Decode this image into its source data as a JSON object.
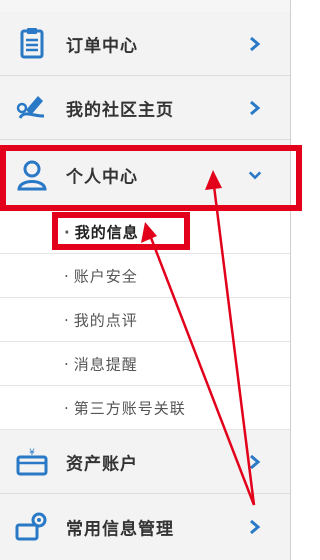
{
  "menu": {
    "order_center": {
      "label": "订单中心",
      "icon": "clipboard-icon"
    },
    "community": {
      "label": "我的社区主页",
      "icon": "edit-pen-icon"
    },
    "personal_center": {
      "label": "个人中心",
      "icon": "user-icon",
      "expanded": true,
      "items": [
        {
          "label": "我的信息",
          "active": true
        },
        {
          "label": "账户安全"
        },
        {
          "label": "我的点评"
        },
        {
          "label": "消息提醒"
        },
        {
          "label": "第三方账号关联"
        }
      ]
    },
    "assets": {
      "label": "资产账户",
      "icon": "wallet-icon"
    },
    "common_info": {
      "label": "常用信息管理",
      "icon": "gear-icon"
    }
  },
  "colors": {
    "accent": "#2a79c7",
    "highlight": "#e2001a"
  }
}
